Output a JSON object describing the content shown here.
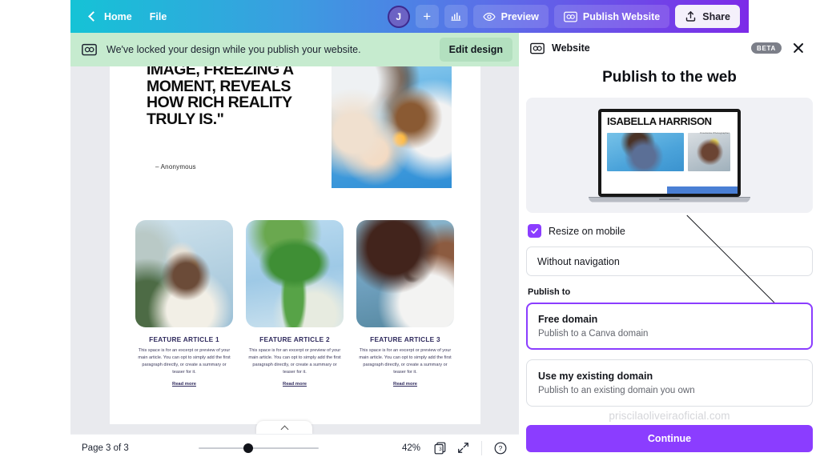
{
  "topbar": {
    "back_icon": "chevron-left-icon",
    "home_label": "Home",
    "file_label": "File",
    "avatar_initial": "J",
    "add_member_icon": "plus-icon",
    "insights_icon": "bar-chart-icon",
    "preview_label": "Preview",
    "preview_icon": "eye-icon",
    "publish_label": "Publish Website",
    "publish_icon": "website-icon",
    "share_label": "Share",
    "share_icon": "upload-icon",
    "gradient_start": "#15c3d6",
    "gradient_end": "#7d2ae8"
  },
  "notice": {
    "icon": "website-lock-icon",
    "message": "We've locked your design while you publish your website.",
    "button_label": "Edit design",
    "background": "#c6ebcf"
  },
  "canvas": {
    "quote_text": "IMAGE, FREEZING A MOMENT, REVEALS HOW RICH REALITY TRULY IS.\"",
    "quote_attribution": "– Anonymous",
    "cards": [
      {
        "title": "FEATURE ARTICLE 1",
        "body": "This space is for an excerpt or preview of your main article. You can opt to simply add the first paragraph directly, or create a summary or teaser for it.",
        "link": "Read more"
      },
      {
        "title": "FEATURE ARTICLE 2",
        "body": "This space is for an excerpt or preview of your main article. You can opt to simply add the first paragraph directly, or create a summary or teaser for it.",
        "link": "Read more"
      },
      {
        "title": "FEATURE ARTICLE 3",
        "body": "This space is for an excerpt or preview of your main article. You can opt to simply add the first paragraph directly, or create a summary or teaser for it.",
        "link": "Read more"
      }
    ]
  },
  "statusbar": {
    "page_label": "Page 3 of 3",
    "zoom_level": "42%",
    "page_count": "3",
    "pages_icon": "pages-icon",
    "fullscreen_icon": "expand-icon",
    "help_icon": "help-circle-icon",
    "slider_icon": "zoom-slider"
  },
  "panel": {
    "header_icon": "website-icon",
    "header_title": "Website",
    "badge": "BETA",
    "close_icon": "close-icon",
    "title": "Publish to the web",
    "preview": {
      "site_name": "ISABELLA HARRISON",
      "site_tagline": "Freelance Photographer",
      "device": "laptop-mockup"
    },
    "resize_checkbox": {
      "label": "Resize on mobile",
      "checked": true,
      "accent": "#8b3dff"
    },
    "navigation_select": {
      "value": "Without navigation",
      "chevron": "chevron-down-icon"
    },
    "publish_to_label": "Publish to",
    "options": [
      {
        "title": "Free domain",
        "desc": "Publish to a Canva domain",
        "selected": true
      },
      {
        "title": "Use my existing domain",
        "desc": "Publish to an existing domain you own",
        "selected": false
      }
    ],
    "watermark": "priscilaoliveiraoficial.com",
    "continue_label": "Continue"
  }
}
